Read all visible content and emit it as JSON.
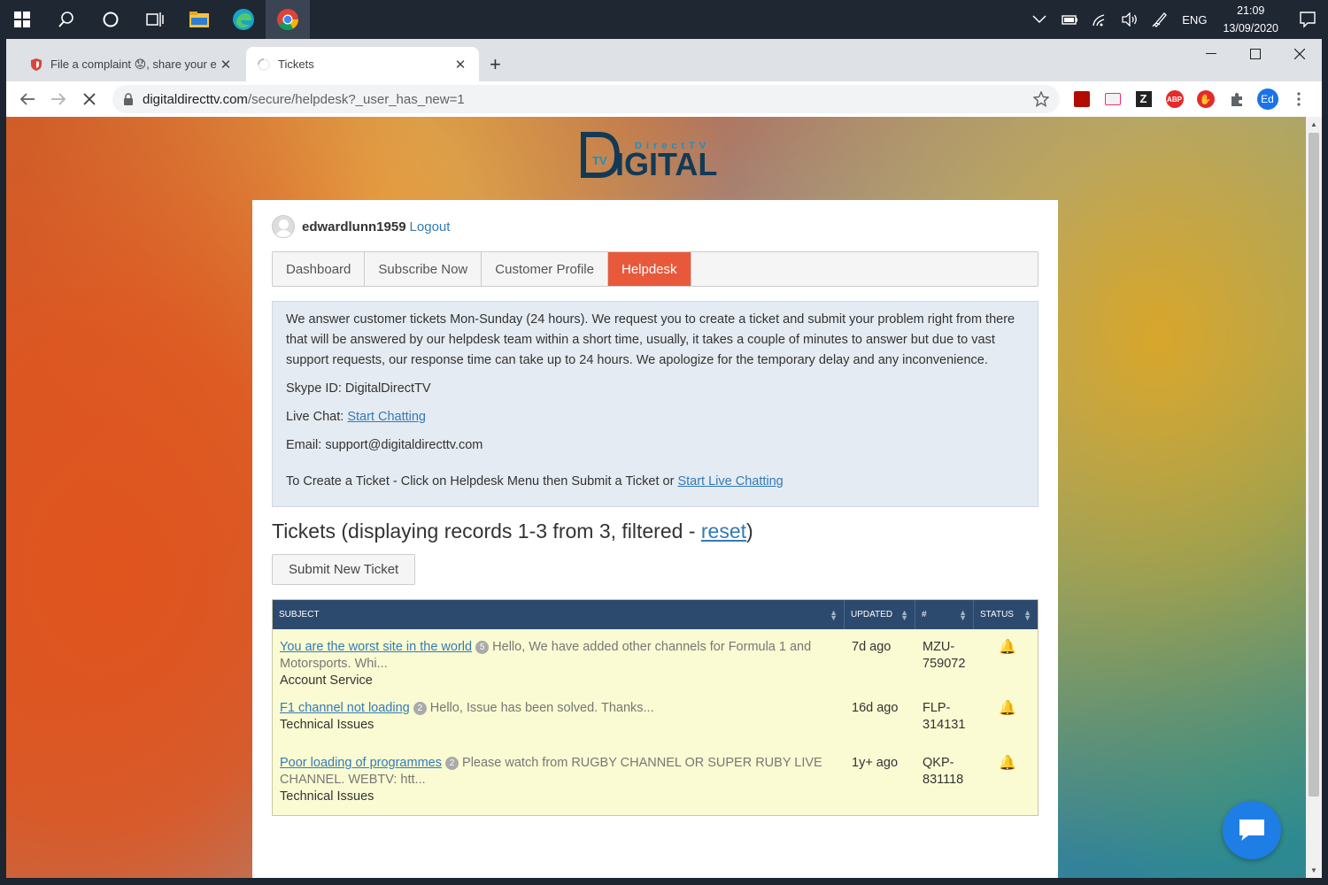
{
  "taskbar": {
    "lang": "ENG",
    "time": "21:09",
    "date": "13/09/2020"
  },
  "browser": {
    "tabs": [
      {
        "title": "File a complaint 😟, share your e",
        "close": "✕"
      },
      {
        "title": "Tickets",
        "close": "✕"
      }
    ],
    "new_tab": "+",
    "url_host": "digitaldirecttv.com",
    "url_path": "/secure/helpdesk?_user_has_new=1",
    "profile_initials": "Ed"
  },
  "page": {
    "logo": {
      "small": "DirectTV",
      "big": "IGITAL",
      "d": "D",
      "tv": "TV"
    },
    "user": {
      "name": "edwardlunn1959",
      "logout": "Logout"
    },
    "nav": [
      "Dashboard",
      "Subscribe Now",
      "Customer Profile",
      "Helpdesk"
    ],
    "info": {
      "intro": "We answer customer tickets Mon-Sunday (24 hours). We request you to create a ticket and submit your problem right from there that will be answered by our helpdesk team within a short time, usually, it takes a couple of minutes to answer but due to vast support requests, our response time can take up to 24 hours. We apologize for the temporary delay and any inconvenience.",
      "skype": "Skype ID: DigitalDirectTV",
      "live_chat_label": "Live Chat: ",
      "live_chat_link": "Start Chatting",
      "email": "Email: support@digitaldirecttv.com",
      "create_text": "To Create a Ticket -  Click on Helpdesk Menu then Submit a Ticket or ",
      "create_link": "Start Live Chatting"
    },
    "tickets_heading": "Tickets (displaying records 1-3 from 3, filtered - ",
    "reset": "reset",
    "heading_close": ")",
    "submit_button": "Submit New Ticket",
    "table": {
      "headers": [
        "SUBJECT",
        "UPDATED",
        "#",
        "STATUS"
      ],
      "rows": [
        {
          "subject": "You are the worst site in the world",
          "count": "5",
          "excerpt": "Hello, We have added other channels for Formula 1 and Motorsports. Whi...",
          "category": "Account Service",
          "updated": "7d ago",
          "id": "MZU-759072"
        },
        {
          "subject": "F1 channel not loading",
          "count": "2",
          "excerpt": "Hello, Issue has been solved. Thanks...",
          "category": "Technical Issues",
          "updated": "16d ago",
          "id": "FLP-314131"
        },
        {
          "subject": "Poor loading of programmes",
          "count": "2",
          "excerpt": "Please watch from RUGBY CHANNEL OR SUPER RUBY LIVE CHANNEL. WEBTV: htt...",
          "category": "Technical Issues",
          "updated": "1y+ ago",
          "id": "QKP-831118"
        }
      ]
    }
  }
}
